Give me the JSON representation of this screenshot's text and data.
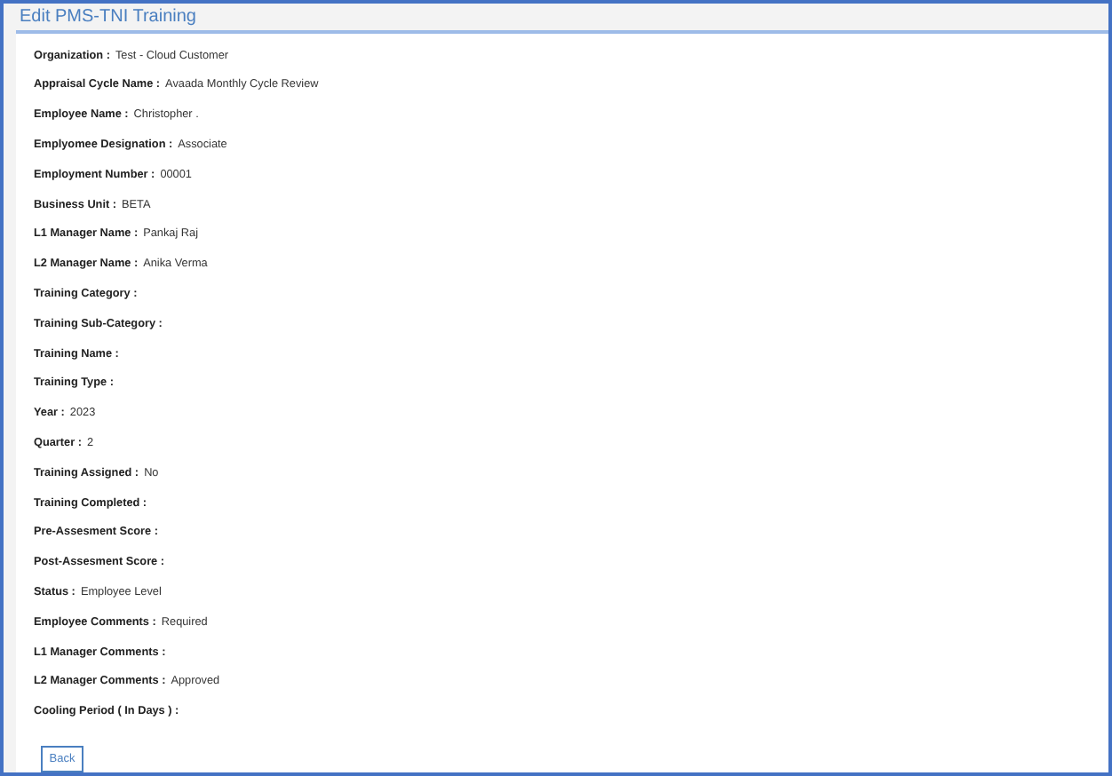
{
  "title": "Edit PMS-TNI Training",
  "fields": [
    {
      "label": "Organization :",
      "value": "Test - Cloud Customer"
    },
    {
      "label": "Appraisal Cycle Name :",
      "value": "Avaada Monthly Cycle Review"
    },
    {
      "label": "Employee Name :",
      "value": "Christopher ."
    },
    {
      "label": "Emplyomee Designation :",
      "value": "Associate"
    },
    {
      "label": "Employment Number :",
      "value": "00001"
    },
    {
      "label": "Business Unit :",
      "value": "BETA"
    },
    {
      "label": "L1 Manager Name :",
      "value": "Pankaj Raj"
    },
    {
      "label": "L2 Manager Name :",
      "value": "Anika Verma"
    },
    {
      "label": "Training Category :"
    },
    {
      "label": "Training Sub-Category :"
    },
    {
      "label": "Training Name :"
    },
    {
      "label": "Training Type :"
    },
    {
      "label": "Year :",
      "value": "2023"
    },
    {
      "label": "Quarter :",
      "value": "2"
    },
    {
      "label": "Training Assigned :",
      "value": "No"
    },
    {
      "label": "Training Completed :"
    },
    {
      "label": "Pre-Assesment Score :"
    },
    {
      "label": "Post-Assesment Score :"
    },
    {
      "label": "Status :",
      "value": "Employee Level"
    },
    {
      "label": "Employee Comments :",
      "value": "Required"
    },
    {
      "label": "L1 Manager Comments :"
    },
    {
      "label": "L2 Manager Comments :",
      "value": "Approved"
    },
    {
      "label": "Cooling Period ( In Days ) :"
    }
  ],
  "back_button": "Back"
}
